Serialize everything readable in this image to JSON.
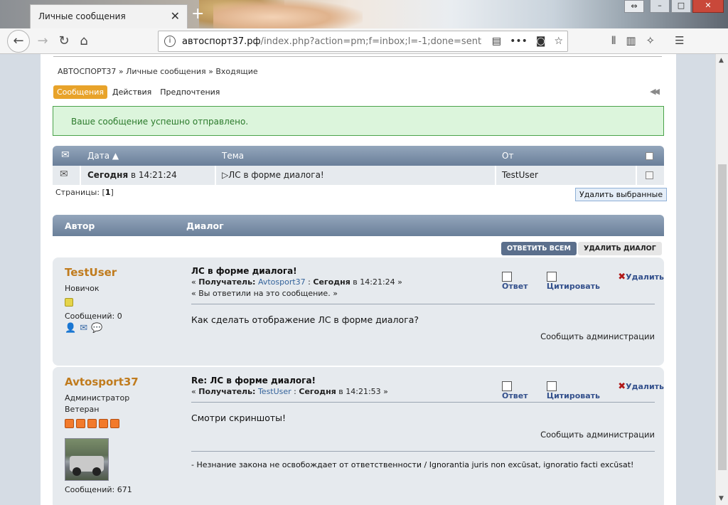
{
  "browser": {
    "tab_title": "Личные сообщения",
    "tab_close": "✕",
    "new_tab": "+",
    "url_domain": "автоспорт37.рф",
    "url_path": "/index.php?action=pm;f=inbox;l=-1;done=sent"
  },
  "breadcrumb": [
    "АВТОСПОРТ37",
    "Личные сообщения",
    "Входящие"
  ],
  "breadcrumb_sep": "»",
  "pm_tabs": [
    "Сообщения",
    "Действия",
    "Предпочтения"
  ],
  "success_message": "Ваше сообщение успешно отправлено.",
  "inbox": {
    "columns": {
      "date": "Дата",
      "subject": "Тема",
      "from": "От"
    },
    "rows": [
      {
        "date_bold": "Сегодня",
        "date_rest": "в 14:21:24",
        "subject": "ЛС в форме диалога!",
        "from": "TestUser"
      }
    ],
    "pages_label": "Страницы:",
    "pages_value": "1",
    "delete_selected": "Удалить выбранные"
  },
  "dialog": {
    "col_author": "Автор",
    "col_dialog": "Диалог",
    "reply_all": "ОТВЕТИТЬ ВСЕМ",
    "delete_dialog": "УДАЛИТЬ ДИАЛОГ",
    "action_reply": "Ответ",
    "action_quote": "Цитировать",
    "action_delete": "Удалить",
    "report": "Сообщить администрации",
    "recipient_label": "Получатель:",
    "posts": [
      {
        "author": "TestUser",
        "rank": "Новичок",
        "stars": 1,
        "posts_label": "Сообщений: 0",
        "subject": "ЛС в форме диалога!",
        "recipient": "Avtosport37",
        "date_bold": "Сегодня",
        "date_rest": "в 14:21:24",
        "note": "« Вы ответили на это сообщение. »",
        "body": "Как сделать отображение ЛС в форме диалога?"
      },
      {
        "author": "Avtosport37",
        "rank": "Администратор",
        "rank2": "Ветеран",
        "stars": 5,
        "posts_label": "Сообщений: 671",
        "subject": "Re: ЛС в форме диалога!",
        "recipient": "TestUser",
        "date_bold": "Сегодня",
        "date_rest": "в 14:21:53",
        "body": "Смотри скриншоты!",
        "signature": "- Незнание закона не освобождает от ответственности / Ignorantia juris non excūsat, ignoratio facti excūsat!"
      }
    ]
  },
  "colors": {
    "accent_tab": "#e8a32a",
    "author_name": "#c07b1d",
    "success_bg": "#dcf5dc",
    "success_border": "#4aa24a",
    "header_gradient_top": "#94a6bc",
    "header_gradient_bottom": "#6a7f99"
  }
}
